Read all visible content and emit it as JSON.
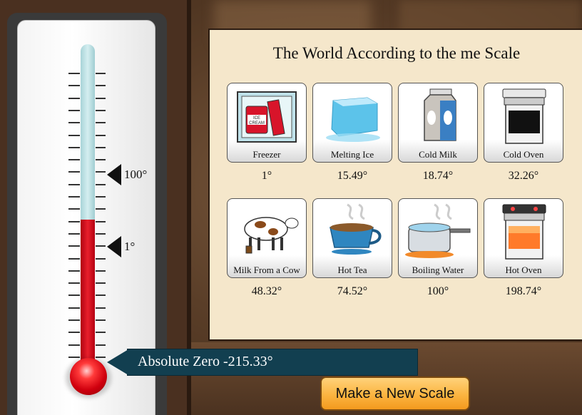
{
  "thermometer": {
    "marker_high_label": "100°",
    "marker_low_label": "1°",
    "absolute_zero_label": "Absolute Zero -215.33°",
    "mercury_level_percent": 46,
    "colors": {
      "mercury": "#e8202c",
      "tube": "#d4eef0",
      "banner": "#123f50"
    }
  },
  "panel": {
    "title": "The World According to the me Scale",
    "items": [
      {
        "label": "Freezer",
        "temp": "1°",
        "icon": "freezer-icon"
      },
      {
        "label": "Melting Ice",
        "temp": "15.49°",
        "icon": "ice-icon"
      },
      {
        "label": "Cold Milk",
        "temp": "18.74°",
        "icon": "milk-carton-icon"
      },
      {
        "label": "Cold Oven",
        "temp": "32.26°",
        "icon": "oven-cold-icon"
      },
      {
        "label": "Milk From a Cow",
        "temp": "48.32°",
        "icon": "cow-icon"
      },
      {
        "label": "Hot Tea",
        "temp": "74.52°",
        "icon": "tea-cup-icon"
      },
      {
        "label": "Boiling Water",
        "temp": "100°",
        "icon": "boiling-pot-icon"
      },
      {
        "label": "Hot Oven",
        "temp": "198.74°",
        "icon": "oven-hot-icon"
      }
    ]
  },
  "button": {
    "label": "Make a New Scale",
    "color": "#fbb440"
  }
}
